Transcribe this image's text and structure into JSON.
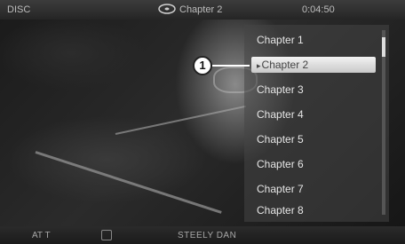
{
  "topbar": {
    "source": "DISC",
    "mode_icon": "dvd-disc-icon",
    "track": "Chapter 2",
    "time": "0:04:50"
  },
  "callout": {
    "number": "1"
  },
  "chapter_list": {
    "items": [
      {
        "label": "Chapter 1",
        "selected": false
      },
      {
        "label": "Chapter 2",
        "selected": true
      },
      {
        "label": "Chapter 3",
        "selected": false
      },
      {
        "label": "Chapter 4",
        "selected": false
      },
      {
        "label": "Chapter 5",
        "selected": false
      },
      {
        "label": "Chapter 6",
        "selected": false
      },
      {
        "label": "Chapter 7",
        "selected": false
      },
      {
        "label": "Chapter 8",
        "selected": false
      }
    ],
    "selected_marker": "▸"
  },
  "bottombar": {
    "rating": "AT T",
    "artist": "STEELY DAN"
  }
}
